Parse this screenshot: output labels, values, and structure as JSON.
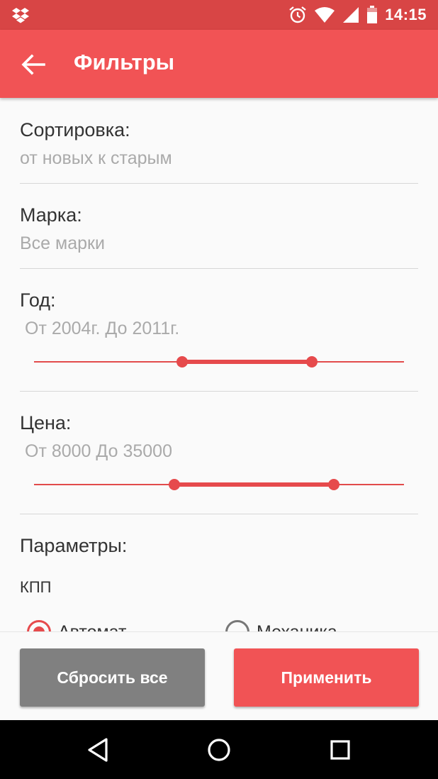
{
  "status_bar": {
    "time": "14:15",
    "icons": [
      "dropbox-icon",
      "alarm-icon",
      "wifi-icon",
      "signal-icon",
      "battery-icon"
    ]
  },
  "toolbar": {
    "title": "Фильтры",
    "back_icon": "arrow-back-icon"
  },
  "filters": {
    "sort": {
      "label": "Сортировка:",
      "value": "от новых к старым"
    },
    "brand": {
      "label": "Марка:",
      "value": "Все марки"
    },
    "year": {
      "label": "Год:",
      "value": "От 2004г. До 2011г.",
      "range_fraction": [
        0.4,
        0.75
      ]
    },
    "price": {
      "label": "Цена:",
      "value": "От 8000 До 35000",
      "range_fraction": [
        0.38,
        0.81
      ]
    },
    "params": {
      "label": "Параметры:",
      "gearbox_label": "КПП",
      "options": [
        {
          "label": "Автомат",
          "checked": true
        },
        {
          "label": "Механика",
          "checked": false
        }
      ]
    }
  },
  "buttons": {
    "reset": "Сбросить все",
    "apply": "Применить"
  },
  "colors": {
    "accent": "#f15355",
    "status_bar": "#d84545",
    "reset_button": "#808080"
  },
  "nav_bar": {
    "icons": [
      "back-triangle-icon",
      "home-circle-icon",
      "recents-square-icon"
    ]
  }
}
